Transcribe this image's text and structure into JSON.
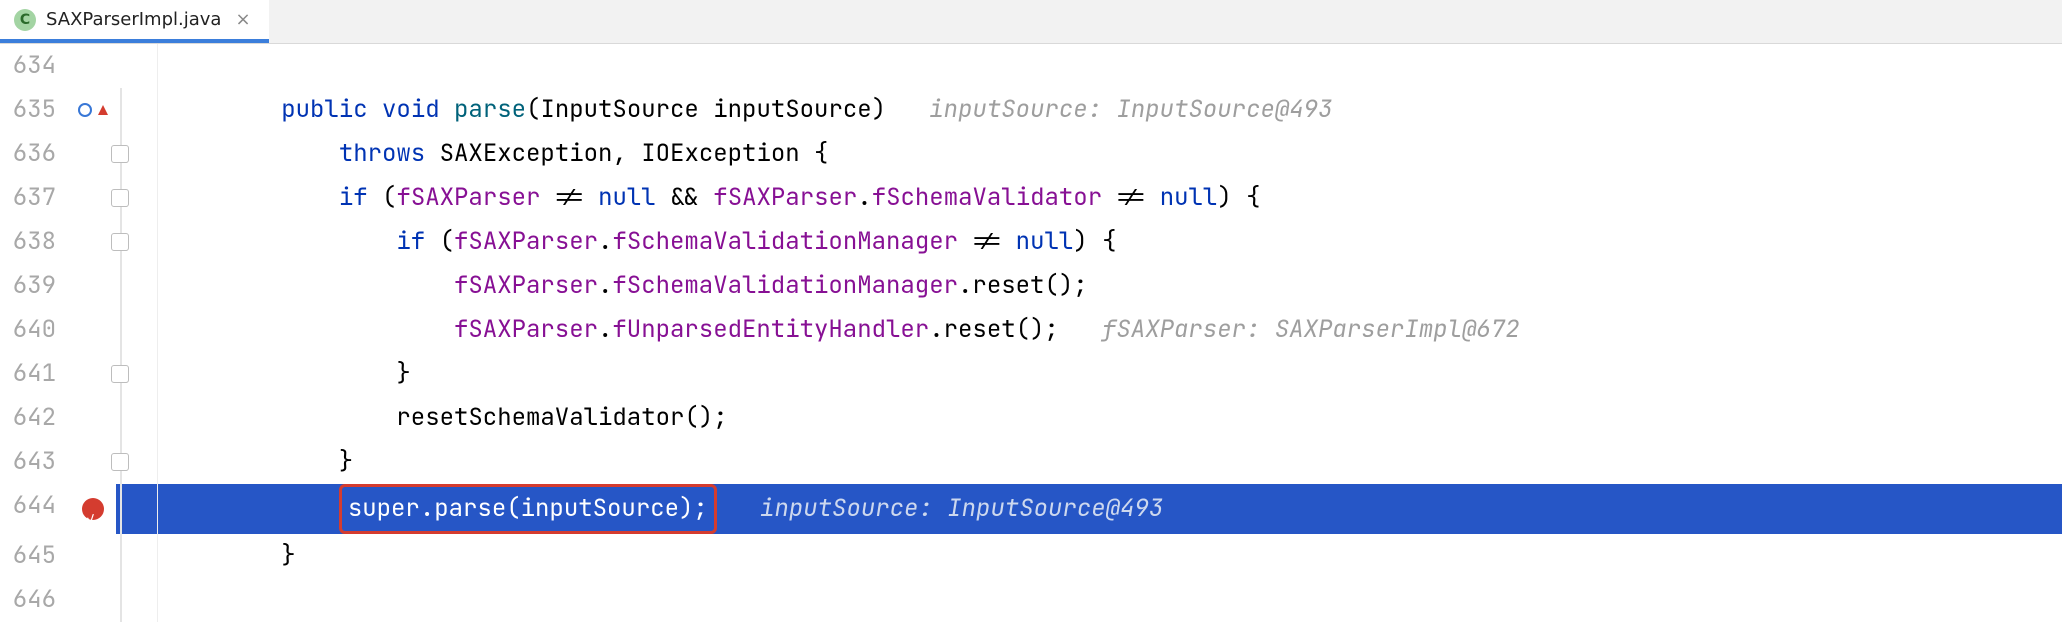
{
  "tab": {
    "filename": "SAXParserImpl.java",
    "icon_letter": "C"
  },
  "gutter": {
    "start": 634,
    "end": 646,
    "breakpoint_line": 644,
    "override_marker_line": 635
  },
  "hints": {
    "line635": "inputSource: InputSource@493",
    "line640": "fSAXParser: SAXParserImpl@672",
    "line644": "inputSource: InputSource@493"
  },
  "code": {
    "l634": "",
    "l635": {
      "kw1": "public",
      "kw2": "void",
      "name": "parse",
      "paramType": "InputSource",
      "paramName": "inputSource"
    },
    "l636": {
      "kw": "throws",
      "ex1": "SAXException",
      "ex2": "IOException"
    },
    "l637": {
      "kw": "if",
      "f1": "fSAXParser",
      "op1": "!=",
      "n1": "null",
      "op2": "&&",
      "f2": "fSAXParser",
      "f3": "fSchemaValidator",
      "op3": "!=",
      "n2": "null"
    },
    "l638": {
      "kw": "if",
      "f1": "fSAXParser",
      "f2": "fSchemaValidationManager",
      "op": "!=",
      "n": "null"
    },
    "l639": {
      "f1": "fSAXParser",
      "f2": "fSchemaValidationManager",
      "call": "reset"
    },
    "l640": {
      "f1": "fSAXParser",
      "f2": "fUnparsedEntityHandler",
      "call": "reset"
    },
    "l641": "}",
    "l642": {
      "call": "resetSchemaValidator"
    },
    "l643": "}",
    "l644": {
      "kw": "super",
      "call": "parse",
      "arg": "inputSource"
    },
    "l645": "}",
    "l646": ""
  }
}
